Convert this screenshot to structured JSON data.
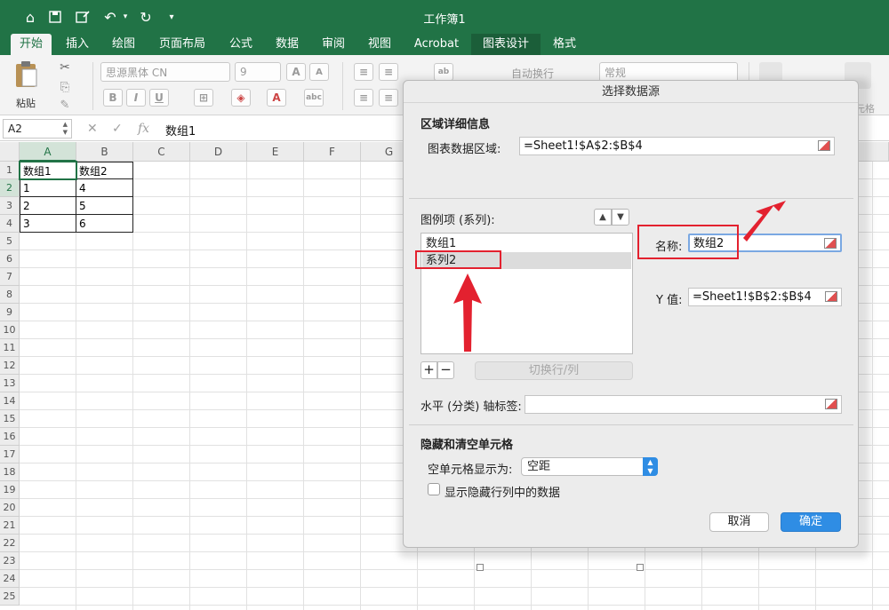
{
  "window": {
    "title": "工作簿1"
  },
  "ribbon_tabs": [
    "开始",
    "插入",
    "绘图",
    "页面布局",
    "公式",
    "数据",
    "审阅",
    "视图",
    "Acrobat",
    "图表设计",
    "格式"
  ],
  "ribbon": {
    "paste_label": "粘贴",
    "font_name": "思源黑体 CN",
    "font_size": "9",
    "wrap_text": "自动换行",
    "number_format": "常规",
    "bold": "B",
    "italic": "I",
    "underline": "U",
    "format_hint": "元格"
  },
  "formula_bar": {
    "name_box": "A2",
    "fx": "fx",
    "value": "数组1"
  },
  "grid": {
    "columns": [
      "A",
      "B",
      "C",
      "D",
      "E",
      "F",
      "G"
    ],
    "rows": [
      "1",
      "2",
      "3",
      "4",
      "5",
      "6",
      "7",
      "8",
      "9",
      "10",
      "11",
      "12",
      "13",
      "14",
      "15",
      "16",
      "17",
      "18",
      "19",
      "20",
      "21",
      "22",
      "23",
      "24",
      "25"
    ],
    "cells": [
      [
        "数组1",
        "数组2"
      ],
      [
        "1",
        "4"
      ],
      [
        "2",
        "5"
      ],
      [
        "3",
        "6"
      ]
    ]
  },
  "dialog": {
    "title": "选择数据源",
    "section_range": "区域详细信息",
    "range_label": "图表数据区域:",
    "range_value": "=Sheet1!$A$2:$B$4",
    "legend_label": "图例项 (系列):",
    "series": [
      "数组1",
      "系列2"
    ],
    "name_label": "名称:",
    "name_value": "数组2",
    "y_label": "Y 值:",
    "y_value": "=Sheet1!$B$2:$B$4",
    "add_btn": "+",
    "remove_btn": "−",
    "switch_btn": "切换行/列",
    "axis_label": "水平 (分类) 轴标签:",
    "axis_value": "",
    "section_hidden": "隐藏和清空单元格",
    "empty_label": "空单元格显示为:",
    "empty_value": "空距",
    "show_hidden_label": "显示隐藏行列中的数据",
    "cancel": "取消",
    "ok": "确定"
  },
  "colors": {
    "excel_green": "#217346",
    "accent_blue": "#2f8de4",
    "annotation_red": "#e3212f"
  }
}
